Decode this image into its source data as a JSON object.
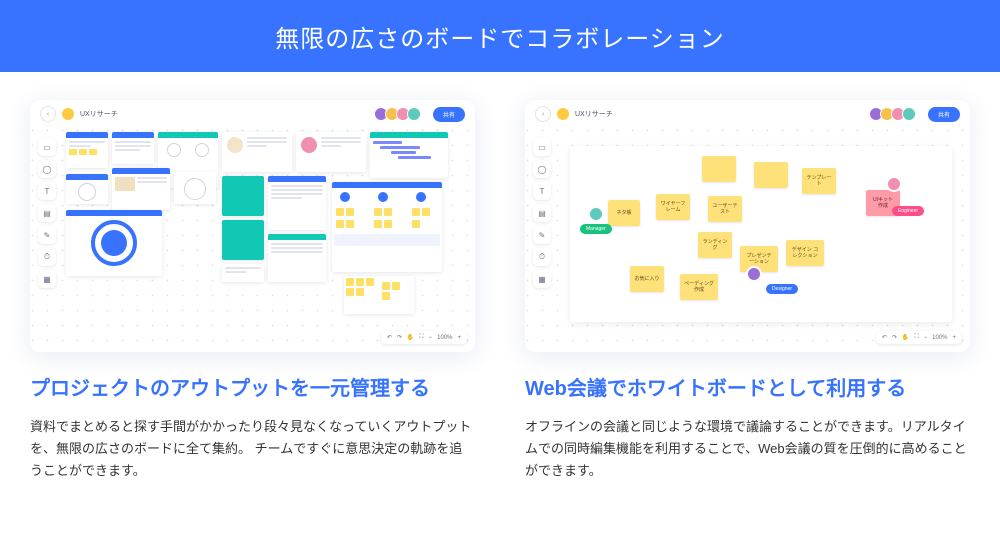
{
  "hero": {
    "title": "無限の広さのボードでコラボレーション"
  },
  "board": {
    "title": "UXリサーチ",
    "share": "共有",
    "zoom": "100%"
  },
  "notes": {
    "n1": "ネタ帳",
    "n2": "ワイヤーフレーム",
    "n3": "ユーザーテスト",
    "n4": "テンプレート",
    "n5": "UIキット 作成",
    "n6": "ランディング",
    "n7": "プレゼンテーション",
    "n8": "デザイン コレクション",
    "n9": "お気に入り",
    "n10": "ペーディング作成"
  },
  "roles": {
    "manager": "Manager",
    "designer": "Designer",
    "engineer": "Engineer"
  },
  "left": {
    "title": "プロジェクトのアウトプットを一元管理する",
    "desc": "資料でまとめると探す手間がかかったり段々見なくなっていくアウトプットを、無限の広さのボードに全て集約。 チームですぐに意思決定の軌跡を追うことができます。"
  },
  "right": {
    "title": "Web会議でホワイトボードとして利用する",
    "desc": "オフラインの会議と同じような環境で議論することができます。リアルタイムでの同時編集機能を利用することで、Web会議の質を圧倒的に高めることができます。"
  }
}
